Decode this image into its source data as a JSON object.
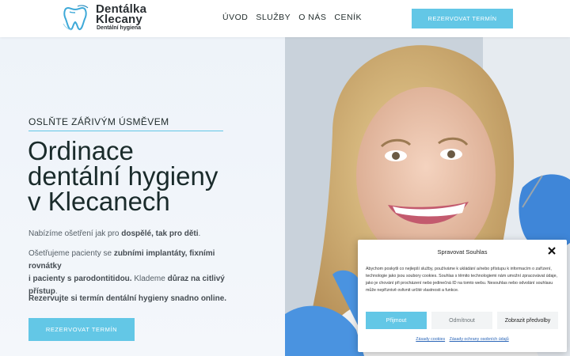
{
  "header": {
    "logo": {
      "title_line1": "Dentálka",
      "title_line2": "Klecany",
      "subtitle": "Dentální hygiena"
    },
    "nav": [
      "ÚVOD",
      "SLUŽBY",
      "O NÁS",
      "CENÍK"
    ],
    "cta_label": "REZERVOVAT TERMÍN"
  },
  "hero": {
    "tagline": "OSLŇTE ZÁŘIVÝM ÚSMĚVEM",
    "headline": [
      "Ordinace",
      "dentální hygieny",
      "v Klecanech"
    ],
    "p1": {
      "a": "Nabízíme ošetření jak pro ",
      "b": "dospělé, tak pro děti",
      "c": "."
    },
    "p2": {
      "a": "Ošetřujeme pacienty se ",
      "b": "zubními implantáty, fixními rovnátky",
      "c": "i pacienty s parodontitidou.",
      "d": " Klademe ",
      "e": "důraz na citlivý přístup",
      "f": "."
    },
    "p3": "Rezervujte si termín dentální hygieny snadno online.",
    "cta_label": "REZERVOVAT TERMÍN"
  },
  "cookie": {
    "title": "Spravovat Souhlas",
    "text": "Abychom poskytli co nejlepší služby, používáme k ukládání a/nebo přístupu k informacím o zařízení, technologie jako jsou soubory cookies. Souhlas s těmito technologiemi nám umožní zpracovávat údaje, jako je chování při procházení nebo jedinečná ID na tomto webu. Nesouhlas nebo odvolání souhlasu může nepříznivě ovlivnit určité vlastnosti a funkce.",
    "accept_label": "Přijmout",
    "reject_label": "Odmítnout",
    "pref_label": "Zobrazit předvolby",
    "links": [
      "Zásady cookies",
      "Zásady ochrany osobních údajů"
    ]
  },
  "colors": {
    "accent": "#63c7e6",
    "text": "#1f2a2a",
    "muted": "#555f66",
    "link": "#2b66b8"
  }
}
